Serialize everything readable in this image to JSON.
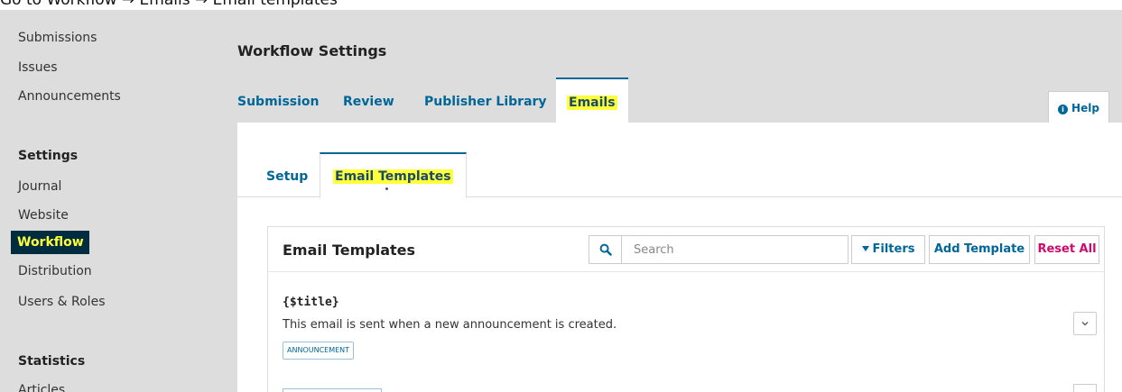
{
  "caption": "Go to Workflow → Emails → Email templates",
  "sidebar": {
    "items_top": [
      "Submissions",
      "Issues",
      "Announcements"
    ],
    "settings_heading": "Settings",
    "settings_items": [
      "Journal",
      "Website",
      "Workflow",
      "Distribution",
      "Users & Roles"
    ],
    "active_item": "Workflow",
    "statistics_heading": "Statistics",
    "statistics_items": [
      "Articles"
    ]
  },
  "page": {
    "title": "Workflow Settings",
    "tabs": [
      "Submission",
      "Review",
      "Publisher Library",
      "Emails"
    ],
    "active_tab": "Emails",
    "help_label": "Help"
  },
  "subtabs": {
    "items": [
      "Setup",
      "Email Templates"
    ],
    "active": "Email Templates"
  },
  "email_templates": {
    "title": "Email Templates",
    "search_placeholder": "Search",
    "filters_label": "Filters",
    "add_label": "Add Template",
    "reset_label": "Reset All",
    "rows": [
      {
        "title": "{$title}",
        "description": "This email is sent when a new announcement is created.",
        "badge": "ANNOUNCEMENT"
      }
    ]
  },
  "colors": {
    "highlight": "#ffff3a",
    "link": "#006798",
    "danger": "#d00a6c",
    "active_nav_bg": "#002c40"
  },
  "icons": [
    "search-icon",
    "filter-icon",
    "help-icon",
    "chevron-down-icon"
  ]
}
